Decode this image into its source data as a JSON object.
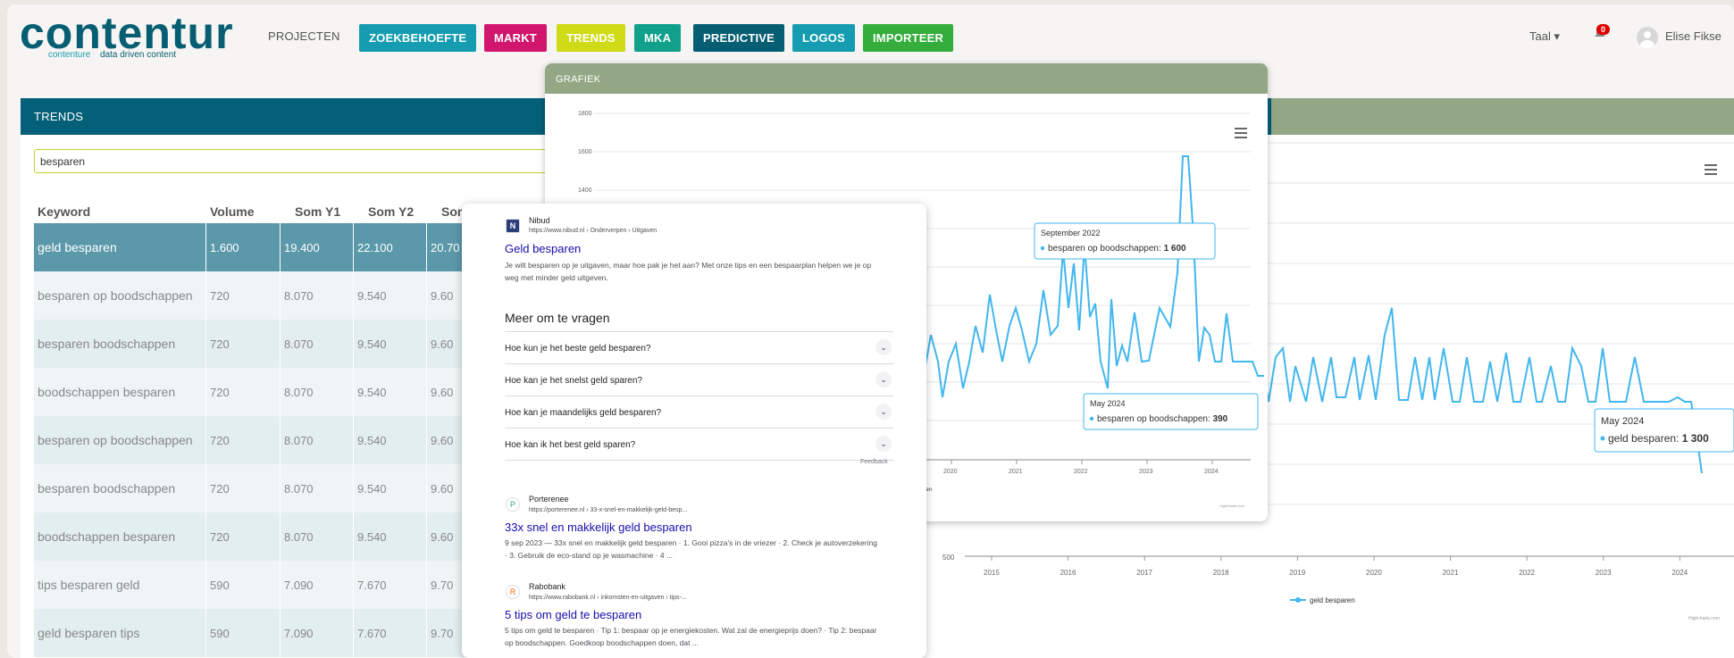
{
  "logo": {
    "wordmark": "contentur",
    "tagline_prefix": "contenture",
    "tagline_rest": "data driven content"
  },
  "nav": {
    "projecten": "PROJECTEN",
    "buttons": [
      {
        "label": "ZOEKBEHOEFTE",
        "color": "#169cb0"
      },
      {
        "label": "MARKT",
        "color": "#d2166e"
      },
      {
        "label": "TRENDS",
        "color": "#cedb16"
      },
      {
        "label": "MKA",
        "color": "#11a08b"
      },
      {
        "label": "PREDICTIVE",
        "color": "#075e72"
      },
      {
        "label": "LOGOS",
        "color": "#169cb0"
      },
      {
        "label": "IMPORTEER",
        "color": "#34ad3c"
      }
    ]
  },
  "header_right": {
    "language": "Taal",
    "notifications": "0",
    "user": "Elise Fikse"
  },
  "trends": {
    "title": "TRENDS",
    "search_value": "besparen",
    "columns": [
      "Keyword",
      "Volume",
      "Som Y1",
      "Som Y2",
      "Som"
    ],
    "rows": [
      {
        "keyword": "geld besparen",
        "volume": "1.600",
        "y1": "19.400",
        "y2": "22.100",
        "y3": "20.70"
      },
      {
        "keyword": "besparen op boodschappen",
        "volume": "720",
        "y1": "8.070",
        "y2": "9.540",
        "y3": "9.60"
      },
      {
        "keyword": "besparen boodschappen",
        "volume": "720",
        "y1": "8.070",
        "y2": "9.540",
        "y3": "9.60"
      },
      {
        "keyword": "boodschappen besparen",
        "volume": "720",
        "y1": "8.070",
        "y2": "9.540",
        "y3": "9.60"
      },
      {
        "keyword": "besparen op boodschappen",
        "volume": "720",
        "y1": "8.070",
        "y2": "9.540",
        "y3": "9.60"
      },
      {
        "keyword": "besparen boodschappen",
        "volume": "720",
        "y1": "8.070",
        "y2": "9.540",
        "y3": "9.60"
      },
      {
        "keyword": "boodschappen besparen",
        "volume": "720",
        "y1": "8.070",
        "y2": "9.540",
        "y3": "9.60"
      },
      {
        "keyword": "tips besparen geld",
        "volume": "590",
        "y1": "7.090",
        "y2": "7.670",
        "y3": "9.70"
      },
      {
        "keyword": "geld besparen tips",
        "volume": "590",
        "y1": "7.090",
        "y2": "7.670",
        "y3": "9.70"
      }
    ]
  },
  "grafiek": {
    "title": "GRAFIEK"
  },
  "google": {
    "result1": {
      "site": "Nibud",
      "url": "https://www.nibud.nl › Onderverpen › Uitgaven",
      "title": "Geld besparen",
      "snippet": "Je wilt besparen op je uitgaven, maar hoe pak je het aan? Met onze tips en een bespaarplan helpen we je op weg met minder geld uitgeven."
    },
    "paa_title": "Meer om te vragen",
    "paa": [
      "Hoe kun je het beste geld besparen?",
      "Hoe kan je het snelst geld sparen?",
      "Hoe kan je maandelijks geld besparen?",
      "Hoe kan ik het best geld sparen?"
    ],
    "feedback": "Feedback",
    "result2": {
      "site": "Porterenee",
      "url": "https://porterenee.nl › 33-x-snel-en-makkelijk-geld-besp...",
      "title": "33x snel en makkelijk geld besparen",
      "snippet": "9 sep 2023 — 33x snel en makkelijk geld besparen · 1. Gooi pizza's in de vriezer · 2. Check je autoverzekering · 3. Gebruik de eco-stand op je wasmachine · 4 ..."
    },
    "result3": {
      "site": "Rabobank",
      "url": "https://www.rabobank.nl › inkomsten-en-uitgaven › tips-...",
      "title": "5 tips om geld te besparen",
      "snippet": "5 tips om geld te besparen · Tip 1: bespaar op je energiekosten. Wat zal de energieprijs doen? · Tip 2: bespaar op boodschappen. Goedkoop boodschappen doen, dat ..."
    }
  },
  "chart_data": [
    {
      "type": "line",
      "series": [
        {
          "name": "besparen op boodschappen",
          "color": "#41b6ef"
        }
      ],
      "ylim": [
        1200,
        1800
      ],
      "yticks": [
        "1800",
        "1600",
        "1400"
      ],
      "xticks": [
        "2020",
        "2021",
        "2022",
        "2023",
        "2024"
      ],
      "legend_partial": "chappen",
      "credits": "Highcharts.com",
      "tooltips": [
        {
          "label": "September 2022",
          "series": "besparen op boodschappen",
          "value": "1 600"
        },
        {
          "label": "May 2024",
          "series": "besparen op boodschappen",
          "value": "390"
        }
      ]
    },
    {
      "type": "line",
      "series": [
        {
          "name": "geld besparen",
          "color": "#41b6ef"
        }
      ],
      "yticks": [
        "500"
      ],
      "xticks": [
        "2015",
        "2016",
        "2017",
        "2018",
        "2019",
        "2020",
        "2021",
        "2022",
        "2023",
        "2024"
      ],
      "legend": "geld besparen",
      "credits": "Highcharts.com",
      "tooltips": [
        {
          "label": "May 2024",
          "series": "geld besparen",
          "value": "1 300"
        }
      ]
    }
  ]
}
